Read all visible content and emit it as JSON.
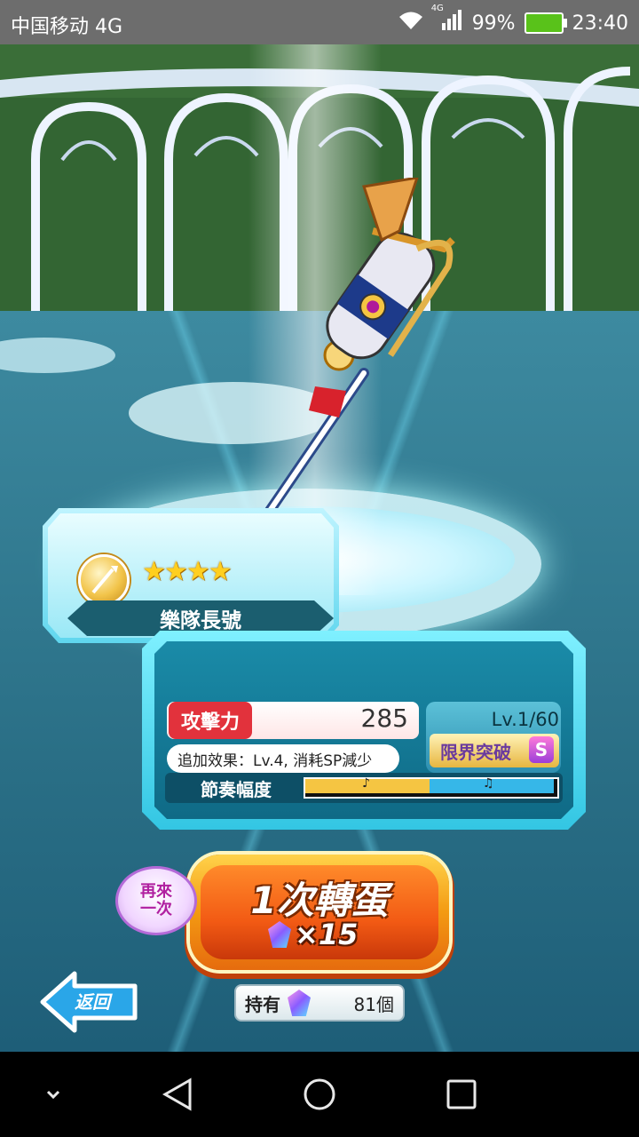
{
  "status_bar": {
    "carrier": "中国移动 4G",
    "network": "4G",
    "battery": "99%",
    "time": "23:40"
  },
  "weapon": {
    "name": "樂隊長號",
    "rarity_stars": 4,
    "stars_text": "★★★★"
  },
  "stats": {
    "attack_label": "攻擊力",
    "attack_value": "285",
    "effect_text": "追加效果：Lv.4, 消耗SP減少",
    "level_text": "Lv.1/60",
    "limit_break_label": "限界突破",
    "limit_break_badge": "S",
    "rhythm_label": "節奏幅度",
    "rhythm_yellow_fraction": 0.5
  },
  "gacha": {
    "again_line1": "再來",
    "again_line2": "一次",
    "button_label": "1次轉蛋",
    "cost_text": "×15"
  },
  "footer": {
    "back_label": "返回",
    "owned_label": "持有",
    "owned_count": "81個"
  },
  "colors": {
    "attack_red": "#e2323c",
    "panel_cyan": "#33c6e3",
    "button_orange": "#f25a14",
    "star_gold": "#ffcf1f"
  }
}
